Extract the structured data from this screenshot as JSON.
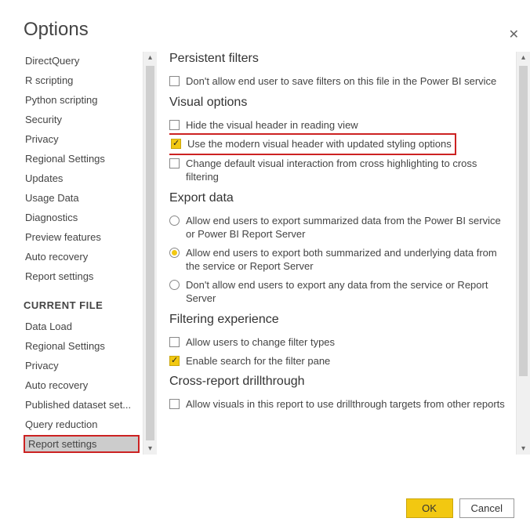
{
  "title": "Options",
  "sidebar": {
    "global_items": [
      "DirectQuery",
      "R scripting",
      "Python scripting",
      "Security",
      "Privacy",
      "Regional Settings",
      "Updates",
      "Usage Data",
      "Diagnostics",
      "Preview features",
      "Auto recovery",
      "Report settings"
    ],
    "current_heading": "CURRENT FILE",
    "current_items": [
      "Data Load",
      "Regional Settings",
      "Privacy",
      "Auto recovery",
      "Published dataset set...",
      "Query reduction",
      "Report settings"
    ],
    "selected": "Report settings"
  },
  "main": {
    "sections": [
      {
        "heading": "Persistent filters",
        "options": [
          {
            "type": "checkbox",
            "checked": false,
            "label": "Don't allow end user to save filters on this file in the Power BI service"
          }
        ]
      },
      {
        "heading": "Visual options",
        "options": [
          {
            "type": "checkbox",
            "checked": false,
            "label": "Hide the visual header in reading view"
          },
          {
            "type": "checkbox",
            "checked": true,
            "highlight": true,
            "label": "Use the modern visual header with updated styling options"
          },
          {
            "type": "checkbox",
            "checked": false,
            "label": "Change default visual interaction from cross highlighting to cross filtering"
          }
        ]
      },
      {
        "heading": "Export data",
        "options": [
          {
            "type": "radio",
            "checked": false,
            "label": "Allow end users to export summarized data from the Power BI service or Power BI Report Server"
          },
          {
            "type": "radio",
            "checked": true,
            "label": "Allow end users to export both summarized and underlying data from the service or Report Server"
          },
          {
            "type": "radio",
            "checked": false,
            "label": "Don't allow end users to export any data from the service or Report Server"
          }
        ]
      },
      {
        "heading": "Filtering experience",
        "options": [
          {
            "type": "checkbox",
            "checked": false,
            "label": "Allow users to change filter types"
          },
          {
            "type": "checkbox",
            "checked": true,
            "label": "Enable search for the filter pane"
          }
        ]
      },
      {
        "heading": "Cross-report drillthrough",
        "options": [
          {
            "type": "checkbox",
            "checked": false,
            "label": "Allow visuals in this report to use drillthrough targets from other reports"
          }
        ]
      }
    ]
  },
  "buttons": {
    "ok": "OK",
    "cancel": "Cancel"
  }
}
